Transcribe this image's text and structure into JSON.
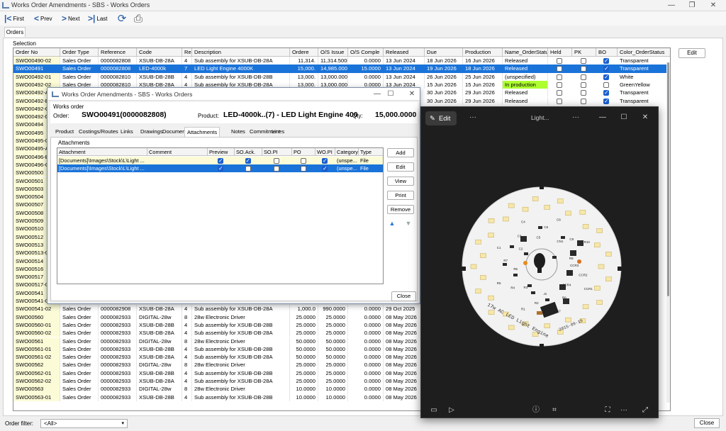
{
  "window": {
    "title": "Works Order Amendments - SBS - Works Orders",
    "min": "—",
    "restore": "❐",
    "close": "✕"
  },
  "toolbar": {
    "first": "First",
    "prev": "Prev",
    "next": "Next",
    "last": "Last"
  },
  "tab": "Orders",
  "selection_label": "Selection",
  "edit_label": "Edit",
  "columns": [
    "Order No",
    "Order Type",
    "Reference",
    "Code",
    "Re",
    "Description",
    "Ordere",
    "O/S Issue",
    "O/S Comple",
    "Released",
    "Due",
    "Production",
    "Name_OrderStatu",
    "Held",
    "PK",
    "BO",
    "Color_OrderStatus"
  ],
  "rows": [
    {
      "no": "SWO00490-02",
      "type": "Sales Order",
      "ref": "0000082808",
      "code": "XSUB-DB-28A",
      "re": "4",
      "desc": "Sub assembly for XSUB-DB-28A",
      "ord": "11,314.",
      "osi": "11,314.5000",
      "osc": "0.0000",
      "rel": "13 Jun 2024",
      "due": "18 Jun 2026",
      "prod": "16 Jun 2026",
      "status": "Released",
      "held": false,
      "pk": false,
      "bo": true,
      "color": "Transparent"
    },
    {
      "no": "SWO00491",
      "type": "Sales Order",
      "ref": "0000082808",
      "code": "LED-4000k",
      "re": "7",
      "desc": "LED Light Engine 4000K",
      "ord": "15,000.",
      "osi": "14,985.0000",
      "osc": "15.0000",
      "rel": "13 Jun 2024",
      "due": "19 Jun 2026",
      "prod": "18 Jun 2026",
      "status": "Released",
      "held": false,
      "pk": false,
      "bo": true,
      "color": "Transparent",
      "sel": true
    },
    {
      "no": "SWO00492-01",
      "type": "Sales Order",
      "ref": "0000082810",
      "code": "XSUB-DB-28B",
      "re": "4",
      "desc": "Sub assembly for XSUB-DB-28B",
      "ord": "13,000.",
      "osi": "13,000.0000",
      "osc": "0.0000",
      "rel": "13 Jun 2024",
      "due": "26 Jun 2026",
      "prod": "25 Jun 2026",
      "status": "(unspecified)",
      "held": false,
      "pk": false,
      "bo": true,
      "color": "White"
    },
    {
      "no": "SWO00492-02",
      "type": "Sales Order",
      "ref": "0000082810",
      "code": "XSUB-DB-28A",
      "re": "4",
      "desc": "Sub assembly for XSUB-DB-28A",
      "ord": "13,000.",
      "osi": "13,000.0000",
      "osc": "0.0000",
      "rel": "13 Jun 2024",
      "due": "15 Jun 2026",
      "prod": "15 Jun 2026",
      "status": "In production",
      "held": false,
      "pk": false,
      "bo": false,
      "color": "GreenYellow"
    },
    {
      "no": "SWO00492-A",
      "prod": "29 Jun 2026",
      "due": "30 Jun 2026",
      "status": "Released",
      "held": false,
      "pk": false,
      "bo": true,
      "color": "Transparent"
    },
    {
      "no": "SWO00492-B",
      "prod": "29 Jun 2026",
      "due": "30 Jun 2026",
      "status": "Released",
      "held": false,
      "pk": false,
      "bo": true,
      "color": "Transparent"
    },
    {
      "no": "SWO00492-C"
    },
    {
      "no": "SWO00492-D"
    },
    {
      "no": "SWO00494"
    },
    {
      "no": "SWO00495"
    },
    {
      "no": "SWO00495-0"
    },
    {
      "no": "SWO00495-A"
    },
    {
      "no": "SWO00496-B"
    },
    {
      "no": "SWO00496-C"
    },
    {
      "no": "SWO00500"
    },
    {
      "no": "SWO00501"
    },
    {
      "no": "SWO00503"
    },
    {
      "no": "SWO00504"
    },
    {
      "no": "SWO00507"
    },
    {
      "no": "SWO00508"
    },
    {
      "no": "SWO00509"
    },
    {
      "no": "SWO00510"
    },
    {
      "no": "SWO00512"
    },
    {
      "no": "SWO00513"
    },
    {
      "no": "SWO00513-0"
    },
    {
      "no": "SWO00514"
    },
    {
      "no": "SWO00516"
    },
    {
      "no": "SWO00517"
    },
    {
      "no": "SWO00517-0"
    },
    {
      "no": "SWO00541"
    },
    {
      "no": "SWO00541-0"
    },
    {
      "no": "SWO00541-02",
      "type": "Sales Order",
      "ref": "0000082908",
      "code": "XSUB-DB-28A",
      "re": "4",
      "desc": "Sub assembly for XSUB-DB-28A",
      "ord": "1,000.0",
      "osi": "990.0000",
      "osc": "0.0000",
      "rel": "29 Oct 2025"
    },
    {
      "no": "SWO00560",
      "type": "Sales Order",
      "ref": "0000082933",
      "code": "DIGITAL-28w",
      "re": "8",
      "desc": "28w Electronic Driver",
      "ord": "25.0000",
      "osi": "25.0000",
      "osc": "0.0000",
      "rel": "08 May 2026"
    },
    {
      "no": "SWO00560-01",
      "type": "Sales Order",
      "ref": "0000082933",
      "code": "XSUB-DB-28B",
      "re": "4",
      "desc": "Sub assembly for XSUB-DB-28B",
      "ord": "25.0000",
      "osi": "25.0000",
      "osc": "0.0000",
      "rel": "08 May 2026"
    },
    {
      "no": "SWO00560-02",
      "type": "Sales Order",
      "ref": "0000082933",
      "code": "XSUB-DB-28A",
      "re": "4",
      "desc": "Sub assembly for XSUB-DB-28A",
      "ord": "25.0000",
      "osi": "25.0000",
      "osc": "0.0000",
      "rel": "08 May 2026"
    },
    {
      "no": "SWO00561",
      "type": "Sales Order",
      "ref": "0000082933",
      "code": "DIGITAL-28w",
      "re": "8",
      "desc": "28w Electronic Driver",
      "ord": "50.0000",
      "osi": "50.0000",
      "osc": "0.0000",
      "rel": "08 May 2026"
    },
    {
      "no": "SWO00561-01",
      "type": "Sales Order",
      "ref": "0000082933",
      "code": "XSUB-DB-28B",
      "re": "4",
      "desc": "Sub assembly for XSUB-DB-28B",
      "ord": "50.0000",
      "osi": "50.0000",
      "osc": "0.0000",
      "rel": "08 May 2026"
    },
    {
      "no": "SWO00561-02",
      "type": "Sales Order",
      "ref": "0000082933",
      "code": "XSUB-DB-28A",
      "re": "4",
      "desc": "Sub assembly for XSUB-DB-28A",
      "ord": "50.0000",
      "osi": "50.0000",
      "osc": "0.0000",
      "rel": "08 May 2026"
    },
    {
      "no": "SWO00562",
      "type": "Sales Order",
      "ref": "0000082933",
      "code": "DIGITAL-28w",
      "re": "8",
      "desc": "28w Electronic Driver",
      "ord": "25.0000",
      "osi": "25.0000",
      "osc": "0.0000",
      "rel": "08 May 2026"
    },
    {
      "no": "SWO00562-01",
      "type": "Sales Order",
      "ref": "0000082933",
      "code": "XSUB-DB-28B",
      "re": "4",
      "desc": "Sub assembly for XSUB-DB-28B",
      "ord": "25.0000",
      "osi": "25.0000",
      "osc": "0.0000",
      "rel": "08 May 2026"
    },
    {
      "no": "SWO00562-02",
      "type": "Sales Order",
      "ref": "0000082933",
      "code": "XSUB-DB-28A",
      "re": "4",
      "desc": "Sub assembly for XSUB-DB-28A",
      "ord": "25.0000",
      "osi": "25.0000",
      "osc": "0.0000",
      "rel": "08 May 2026"
    },
    {
      "no": "SWO00563",
      "type": "Sales Order",
      "ref": "0000082933",
      "code": "DIGITAL-28w",
      "re": "8",
      "desc": "28w Electronic Driver",
      "ord": "10.0000",
      "osi": "10.0000",
      "osc": "0.0000",
      "rel": "08 May 2026"
    },
    {
      "no": "SWO00563-01",
      "type": "Sales Order",
      "ref": "0000082933",
      "code": "XSUB-DB-28B",
      "re": "4",
      "desc": "Sub assembly for XSUB-DB-28B",
      "ord": "10.0000",
      "osi": "10.0000",
      "osc": "0.0000",
      "rel": "08 May 2026"
    }
  ],
  "footer": {
    "filter_label": "Order filter:",
    "filter_value": "<All>",
    "close": "Close"
  },
  "dialog": {
    "title": "Works Order Amendments - SBS - Works Orders",
    "section": "Works order",
    "order_label": "Order:",
    "order_value": "SWO00491(0000082808)",
    "product_label": "Product:",
    "product_value": "LED-4000k..(7) - LED Light Engine 400",
    "qty_label": "Qty:",
    "qty_value": "15,000.0000",
    "tabs": [
      "Product",
      "Costings/Routes",
      "Links",
      "Drawings",
      "Documents",
      "Attachments",
      "Notes",
      "Commitment",
      "Lines"
    ],
    "attachments_label": "Attachments",
    "att_columns": [
      "Attachment",
      "Comment",
      "Preview",
      "SO.Ack.",
      "SO.PI",
      "PO",
      "WO.PI",
      "Category",
      "Type"
    ],
    "att_rows": [
      {
        "file": "[Documents]\\Images\\Stock\\L\\Light ...",
        "preview": true,
        "soack": true,
        "sopi": false,
        "po": false,
        "wopi": true,
        "cat": "(unspe...",
        "type": "File"
      },
      {
        "file": "[Documents]\\Images\\Stock\\L\\Light ...",
        "preview": true,
        "soack": false,
        "sopi": false,
        "po": false,
        "wopi": true,
        "cat": "(unspe...",
        "type": "File",
        "sel": true
      }
    ],
    "buttons": {
      "add": "Add",
      "edit": "Edit",
      "view": "View",
      "print": "Print",
      "remove": "Remove",
      "close": "Close"
    }
  },
  "viewer": {
    "edit": "Edit",
    "title": "Light...",
    "pcb_labels": [
      "CCR3",
      "CCR2",
      "CCR1",
      "CCR4",
      "R8",
      "C7",
      "J1",
      "R2",
      "R1",
      "R3",
      "R4",
      "R5",
      "R6",
      "R7",
      "C1",
      "C2",
      "C3",
      "C4",
      "C5",
      "C6",
      "C8",
      "CN1",
      "C9",
      "R10",
      "R9"
    ],
    "pcb_text": "17w AC LED Light Engine",
    "pcb_date": "2015-09-19"
  }
}
